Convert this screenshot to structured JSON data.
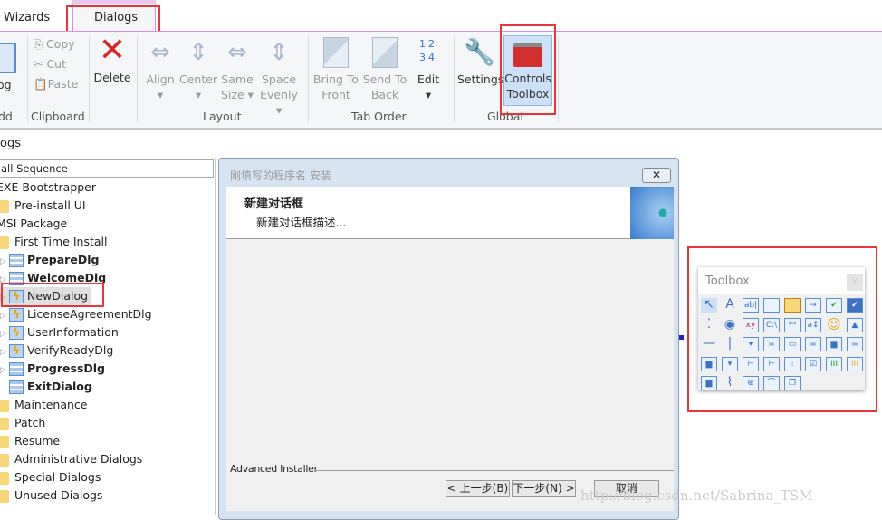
{
  "tabs": [
    {
      "label": "Wizards"
    },
    {
      "label": "Dialogs"
    }
  ],
  "ribbon": {
    "add_dialog_label": "log",
    "add_group": "dd",
    "copy": "Copy",
    "cut": "Cut",
    "paste": "Paste",
    "clipboard_group": "Clipboard",
    "delete": "Delete",
    "align": "Align",
    "center": "Center",
    "same_size_1": "Same",
    "same_size_2": "Size",
    "space_evenly_1": "Space",
    "space_evenly_2": "Evenly",
    "layout_group": "Layout",
    "bring_front_1": "Bring To",
    "bring_front_2": "Front",
    "send_back_1": "Send To",
    "send_back_2": "Back",
    "edit": "Edit",
    "tab_order_group": "Tab Order",
    "settings": "Settings",
    "controls_toolbox_1": "Controls",
    "controls_toolbox_2": "Toolbox",
    "global_group": "Global"
  },
  "panel_title": "ogs",
  "sequence_select": "all Sequence",
  "tree": [
    {
      "label": "EXE Bootstrapper",
      "level": 0,
      "icon": "none"
    },
    {
      "label": "Pre-install UI",
      "level": 1,
      "icon": "folder"
    },
    {
      "label": "MSI Package",
      "level": 0,
      "icon": "none"
    },
    {
      "label": "First Time Install",
      "level": 1,
      "icon": "folder"
    },
    {
      "label": "PrepareDlg",
      "level": 2,
      "icon": "dialog",
      "bold": true
    },
    {
      "label": "WelcomeDlg",
      "level": 2,
      "icon": "dialog",
      "bold": true
    },
    {
      "label": "NewDialog",
      "level": 2,
      "icon": "new-dialog",
      "selected": true
    },
    {
      "label": "LicenseAgreementDlg",
      "level": 2,
      "icon": "new-dialog"
    },
    {
      "label": "UserInformation",
      "level": 2,
      "icon": "new-dialog"
    },
    {
      "label": "VerifyReadyDlg",
      "level": 2,
      "icon": "new-dialog"
    },
    {
      "label": "ProgressDlg",
      "level": 2,
      "icon": "dialog",
      "bold": true
    },
    {
      "label": "ExitDialog",
      "level": 2,
      "icon": "dialog",
      "bold": true
    },
    {
      "label": "Maintenance",
      "level": 1,
      "icon": "folder"
    },
    {
      "label": "Patch",
      "level": 1,
      "icon": "folder"
    },
    {
      "label": "Resume",
      "level": 1,
      "icon": "folder"
    },
    {
      "label": "Administrative Dialogs",
      "level": 1,
      "icon": "folder"
    },
    {
      "label": "Special Dialogs",
      "level": 1,
      "icon": "folder"
    },
    {
      "label": "Unused Dialogs",
      "level": 1,
      "icon": "folder"
    }
  ],
  "dialog": {
    "title": "刚填写的程序名 安装",
    "header_title": "新建对话框",
    "header_desc": "新建对话框描述...",
    "brand": "Advanced Installer",
    "back": "< 上一步(B)",
    "next": "下一步(N) >",
    "cancel": "取消"
  },
  "toolbox": {
    "title": "Toolbox",
    "close": "x",
    "icons": [
      "pointer",
      "text",
      "edit",
      "panel",
      "bitmap",
      "button",
      "checkbox",
      "checked-checkbox",
      "radio-group",
      "radio",
      "dynamic-text",
      "path-edit",
      "password",
      "spin",
      "emoticon",
      "image",
      "line-h",
      "line-v",
      "combo",
      "list",
      "volume-combo",
      "checklist",
      "folder-list",
      "db-list",
      "browse-folder",
      "volume-list",
      "tree",
      "check-tree",
      "feature-tree",
      "check-list",
      "progress-green",
      "progress-yellow",
      "directory",
      "hyperlink",
      "web",
      "tab-header",
      "group"
    ]
  },
  "watermark": "http://blog.csdn.net/Sabrina_TSM",
  "colors": {
    "accent": "#d98fe8",
    "highlight": "#e8353a",
    "selected": "#cce0f7"
  }
}
